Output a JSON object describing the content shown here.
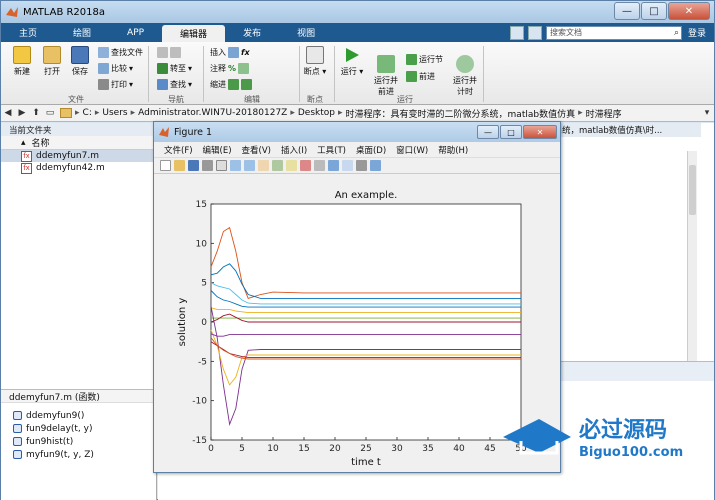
{
  "window": {
    "title": "MATLAB R2018a",
    "min": "—",
    "max": "□",
    "close": "✕"
  },
  "tabs": [
    "主页",
    "绘图",
    "APP",
    "编辑器",
    "发布",
    "视图"
  ],
  "active_tab": "编辑器",
  "search": {
    "placeholder": "搜索文档",
    "user": "登录"
  },
  "ribbon": {
    "file": {
      "new": "新建",
      "open": "打开",
      "save": "保存",
      "find_files": "查找文件",
      "compare": "比较",
      "print": "打印",
      "label": "文件"
    },
    "navigate": {
      "goto": "转至",
      "find": "查找",
      "label": "导航"
    },
    "edit": {
      "insert": "插入",
      "comment": "注释",
      "indent": "缩进",
      "label": "编辑"
    },
    "breakpoints": {
      "bp": "断点",
      "label": "断点"
    },
    "run": {
      "run": "运行",
      "run_advance": "运行并\n前进",
      "run_section": "运行节",
      "advance": "前进",
      "run_time": "运行并\n计时",
      "label": "运行"
    }
  },
  "address": {
    "crumbs": [
      "C:",
      "Users",
      "Administrator.WIN7U-20180127Z",
      "Desktop",
      "时滞程序：具有变时滞的二阶微分系统，matlab数值仿真",
      "时滞程序"
    ]
  },
  "left_panel": {
    "title": "当前文件夹",
    "column": "名称",
    "files": [
      {
        "name": "ddemyfun7.m",
        "selected": true
      },
      {
        "name": "ddemyfun42.m",
        "selected": false
      }
    ],
    "details_title": "ddemyfun7.m  (函数)",
    "functions": [
      "ddemyfun9()",
      "fun9delay(t, y)",
      "fun9hist(t)",
      "myfun9(t, y, Z)"
    ]
  },
  "editor_tab": "分系统，matlab数值仿真\\时...",
  "figure": {
    "title": "Figure 1",
    "menu": [
      "文件(F)",
      "编辑(E)",
      "查看(V)",
      "插入(I)",
      "工具(T)",
      "桌面(D)",
      "窗口(W)",
      "帮助(H)"
    ]
  },
  "chart_data": {
    "type": "line",
    "title": "An example.",
    "xlabel": "time t",
    "ylabel": "solution y",
    "xlim": [
      0,
      50
    ],
    "ylim": [
      -15,
      15
    ],
    "xticks": [
      0,
      5,
      10,
      15,
      20,
      25,
      30,
      35,
      40,
      45,
      50
    ],
    "yticks": [
      -15,
      -10,
      -5,
      0,
      5,
      10,
      15
    ],
    "series": [
      {
        "color": "#d95319",
        "x": [
          0,
          1,
          2,
          3,
          4,
          5,
          6,
          8,
          10,
          15,
          20,
          30,
          40,
          50
        ],
        "y": [
          7,
          9,
          11.5,
          12,
          9,
          5,
          3,
          3.5,
          3.8,
          3.7,
          3.7,
          3.7,
          3.7,
          3.7
        ]
      },
      {
        "color": "#0072bd",
        "x": [
          0,
          1,
          2,
          3,
          4,
          5,
          6,
          8,
          10,
          15,
          20,
          30,
          40,
          50
        ],
        "y": [
          6,
          6.2,
          7,
          7.4,
          6.5,
          4.8,
          3.5,
          3,
          3,
          3,
          3,
          3,
          3,
          3
        ]
      },
      {
        "color": "#4dbeee",
        "x": [
          0,
          1,
          2,
          3,
          4,
          5,
          6,
          8,
          10,
          15,
          20,
          30,
          40,
          50
        ],
        "y": [
          5,
          4.6,
          4.4,
          4.2,
          3.5,
          2.8,
          2.4,
          2.3,
          2.3,
          2.3,
          2.3,
          2.3,
          2.3,
          2.3
        ]
      },
      {
        "color": "#edb120",
        "x": [
          0,
          1,
          2,
          3,
          4,
          5,
          6,
          8,
          10,
          15,
          20,
          30,
          40,
          50
        ],
        "y": [
          1.8,
          1.6,
          1.6,
          1.6,
          1.4,
          1.3,
          1.2,
          1.2,
          1.2,
          1.2,
          1.2,
          1.2,
          1.2,
          1.2
        ]
      },
      {
        "color": "#77ac30",
        "x": [
          0,
          2,
          4,
          6,
          8,
          10,
          20,
          30,
          40,
          50
        ],
        "y": [
          0.5,
          0.5,
          0.5,
          0.5,
          0.5,
          0.5,
          0.5,
          0.5,
          0.5,
          0.5
        ]
      },
      {
        "color": "#a2142f",
        "x": [
          0,
          1,
          2,
          3,
          4,
          5,
          6,
          8,
          10,
          15,
          20,
          30,
          40,
          50
        ],
        "y": [
          0,
          0.3,
          0.8,
          1,
          0.6,
          0.2,
          0,
          0,
          0,
          0,
          0,
          0,
          0,
          0
        ]
      },
      {
        "color": "#7e2f8e",
        "x": [
          0,
          1,
          2,
          3,
          4,
          5,
          6,
          8,
          10,
          15,
          20,
          30,
          40,
          50
        ],
        "y": [
          2,
          -2,
          -8,
          -13,
          -11,
          -6,
          -3.6,
          -3.5,
          -3.5,
          -3.5,
          -3.5,
          -3.5,
          -3.5,
          -3.5
        ]
      },
      {
        "color": "#edb120",
        "x": [
          0,
          1,
          2,
          3,
          4,
          5,
          6,
          8,
          10,
          15,
          20,
          30,
          40,
          50
        ],
        "y": [
          -1,
          -3,
          -6,
          -8,
          -7,
          -4.5,
          -4.2,
          -4.2,
          -4.2,
          -4.2,
          -4.2,
          -4.2,
          -4.2,
          -4.2
        ]
      },
      {
        "color": "#7e2f8e",
        "x": [
          0,
          1,
          2,
          3,
          4,
          5,
          6,
          8,
          10,
          15,
          20,
          30,
          40,
          50
        ],
        "y": [
          -1.5,
          -1.8,
          -1.8,
          -1.6,
          -1.6,
          -1.6,
          -1.6,
          -1.6,
          -1.6,
          -1.6,
          -1.6,
          -1.6,
          -1.6,
          -1.6
        ]
      },
      {
        "color": "#a2142f",
        "x": [
          0,
          1,
          2,
          3,
          4,
          5,
          6,
          8,
          10,
          15,
          20,
          30,
          40,
          50
        ],
        "y": [
          -2.5,
          -3,
          -3.5,
          -4,
          -4.2,
          -4.4,
          -4.5,
          -4.5,
          -4.5,
          -4.5,
          -4.5,
          -4.5,
          -4.5,
          -4.5
        ]
      },
      {
        "color": "#0072bd",
        "x": [
          0,
          1,
          2,
          3,
          4,
          5,
          6,
          8,
          10,
          15,
          20,
          30,
          40,
          50
        ],
        "y": [
          4,
          3.2,
          2.8,
          2.6,
          2.3,
          2,
          1.9,
          1.9,
          1.9,
          1.9,
          1.9,
          1.9,
          1.9,
          1.9
        ]
      },
      {
        "color": "#d95319",
        "x": [
          0,
          1,
          2,
          3,
          4,
          5,
          6,
          8,
          10,
          15,
          20,
          30,
          40,
          50
        ],
        "y": [
          -2,
          -3,
          -3.6,
          -4,
          -4.4,
          -4.6,
          -4.7,
          -4.7,
          -4.7,
          -4.7,
          -4.7,
          -4.7,
          -4.7,
          -4.7
        ]
      }
    ]
  },
  "colors": {
    "ribbon_tab_bg": "#1e5a90",
    "selected_row": "#cdd9e6"
  }
}
